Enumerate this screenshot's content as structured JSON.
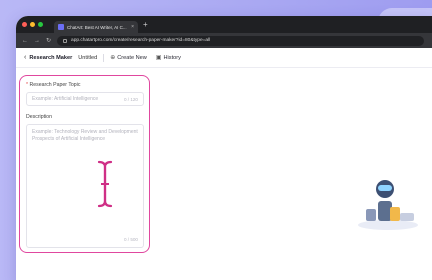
{
  "browser": {
    "tab_title": "ChatArt: Best AI Writer, AI C...",
    "tab_close": "×",
    "new_tab": "+",
    "url": "app.chatartpro.com/create/research-paper-maker?id=80&type=all",
    "nav": {
      "back": "←",
      "forward": "→",
      "reload": "↻"
    }
  },
  "header": {
    "back": "‹",
    "crumb": "Research Maker",
    "doc_title": "Untitled",
    "create_new": "Create New",
    "history": "History"
  },
  "form": {
    "topic_label": "Research Paper Topic",
    "required_mark": "*",
    "topic_placeholder": "Example: Artificial Intelligence",
    "topic_count": "0 / 120",
    "desc_label": "Description",
    "desc_placeholder": "Example: Technology Review and Development Prospects of Artificial Intelligence",
    "desc_count": "0 / 500"
  },
  "colors": {
    "accent_border": "#e0479f",
    "background": "#b9b8f6"
  }
}
